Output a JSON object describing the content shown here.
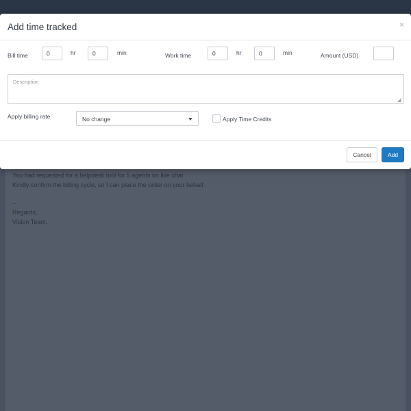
{
  "background_email": {
    "lines": [
      "You had requested for a helpdesk tool for 5 agents on live chat",
      "Kindly confirm the billing cycle, so I can place the order on your behalf.",
      "",
      "--",
      "Regards,",
      "Vision Team."
    ]
  },
  "modal": {
    "title": "Add time tracked",
    "close_glyph": "×",
    "bill_time": {
      "label": "Bill time",
      "hr_value": "0",
      "hr_unit": "hr",
      "min_value": "0",
      "min_unit": "min"
    },
    "work_time": {
      "label": "Work time",
      "hr_value": "0",
      "hr_unit": "hr",
      "min_value": "0",
      "min_unit": "min"
    },
    "amount": {
      "label": "Amount (USD)",
      "value": ""
    },
    "description": {
      "placeholder": "Description",
      "value": ""
    },
    "billing_rate": {
      "label": "Apply billing rate",
      "selected": "No change"
    },
    "time_credits": {
      "label": "Apply Time Credits",
      "checked": false
    },
    "buttons": {
      "cancel": "Cancel",
      "add": "Add"
    }
  },
  "colors": {
    "overlay_bg": "#4a5160",
    "topbar": "#2a3645",
    "primary": "#1f7bc1"
  }
}
